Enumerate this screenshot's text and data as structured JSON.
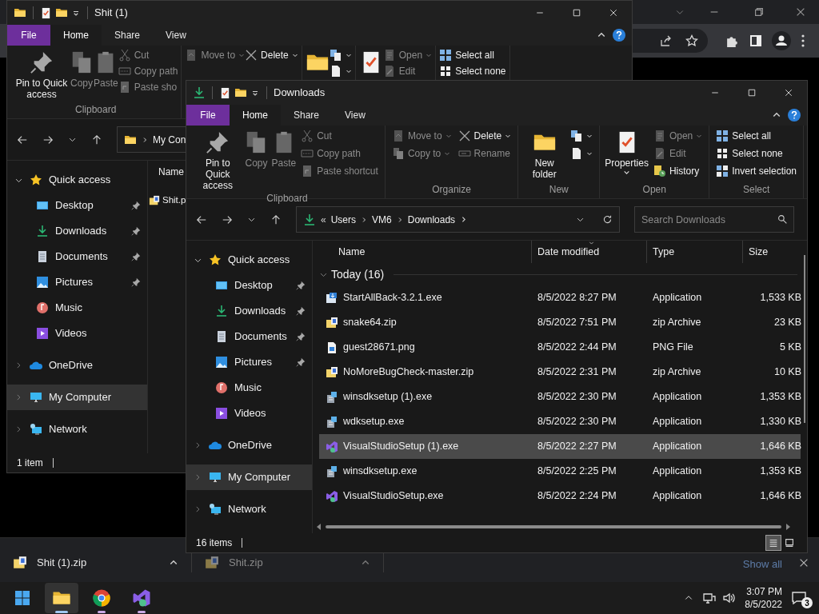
{
  "back_window": {
    "title": "Shit (1)",
    "kind": "folder",
    "file_tab": "File",
    "tabs": [
      {
        "label": "Home",
        "selected": true
      },
      {
        "label": "Share",
        "selected": false
      },
      {
        "label": "View",
        "selected": false
      }
    ],
    "ribbon": [
      {
        "label": "Clipboard",
        "columns": [
          [
            {
              "kind": "pin",
              "label": "Pin to Quick access",
              "disabled": false,
              "menu": false
            }
          ],
          [
            {
              "kind": "copy",
              "label": "Copy",
              "disabled": true,
              "menu": false
            }
          ],
          [
            {
              "kind": "paste",
              "label": "Paste",
              "disabled": true,
              "menu": false
            }
          ],
          [
            {
              "kind": "cut",
              "label": "Cut",
              "disabled": true,
              "menu": false
            },
            {
              "kind": "copypath",
              "label": "Copy path",
              "disabled": true,
              "menu": false
            },
            {
              "kind": "shortcut",
              "label": "Paste sho",
              "disabled": true,
              "menu": false
            }
          ]
        ]
      },
      {
        "columns": [
          [
            {
              "kind": "move",
              "label": "Move to",
              "disabled": true,
              "menu": true
            }
          ],
          [
            {
              "kind": "delete",
              "label": "Delete",
              "disabled": false,
              "menu": true
            }
          ]
        ]
      },
      {
        "columns": [
          [
            {
              "kind": "newfolder",
              "disabled": false,
              "menu": false
            }
          ],
          [
            {
              "kind": "newitem",
              "disabled": false,
              "menu": true
            },
            {
              "kind": "easyaccess",
              "disabled": false,
              "menu": true
            }
          ]
        ]
      },
      {
        "columns": [
          [
            {
              "kind": "properties",
              "disabled": false,
              "menu": false
            }
          ],
          [
            {
              "kind": "open",
              "label": "Open",
              "disabled": true,
              "menu": true
            },
            {
              "kind": "edit",
              "label": "Edit",
              "disabled": true,
              "menu": false
            }
          ]
        ]
      },
      {
        "columns": [
          [
            {
              "kind": "selectall",
              "label": "Select all",
              "disabled": false,
              "menu": false
            },
            {
              "kind": "selectnone",
              "label": "Select none",
              "disabled": false,
              "menu": false
            }
          ]
        ]
      }
    ],
    "address": {
      "crumbs": [
        "My Con"
      ]
    },
    "tree": [
      {
        "label": "Quick access",
        "kind": "star",
        "expanded": true,
        "selected": false,
        "children": [
          {
            "label": "Desktop",
            "kind": "desktop",
            "pinned": true,
            "selected": false
          },
          {
            "label": "Downloads",
            "kind": "download",
            "pinned": true,
            "selected": false
          },
          {
            "label": "Documents",
            "kind": "documents",
            "pinned": true,
            "selected": false
          },
          {
            "label": "Pictures",
            "kind": "pictures",
            "pinned": true,
            "selected": false
          },
          {
            "label": "Music",
            "kind": "music",
            "pinned": false,
            "selected": false
          },
          {
            "label": "Videos",
            "kind": "videos",
            "pinned": false,
            "selected": false
          }
        ]
      },
      {
        "label": "OneDrive",
        "kind": "onedrive",
        "expanded": false,
        "selected": false
      },
      {
        "label": "My Computer",
        "kind": "computer",
        "expanded": false,
        "selected": true
      },
      {
        "label": "Network",
        "kind": "network",
        "expanded": false,
        "selected": false
      }
    ],
    "columns": [
      {
        "label": "Name"
      }
    ],
    "rows": [
      {
        "name": "Shit.p",
        "kind": "zip",
        "selected": false
      }
    ],
    "status": "1 item"
  },
  "front_window": {
    "title": "Downloads",
    "kind": "download",
    "file_tab": "File",
    "tabs": [
      {
        "label": "Home",
        "selected": true
      },
      {
        "label": "Share",
        "selected": false
      },
      {
        "label": "View",
        "selected": false
      }
    ],
    "ribbon": [
      {
        "label": "Clipboard",
        "columns": [
          [
            {
              "kind": "pin",
              "label": "Pin to Quick access",
              "disabled": false,
              "menu": false
            }
          ],
          [
            {
              "kind": "copy",
              "label": "Copy",
              "disabled": true,
              "menu": false
            }
          ],
          [
            {
              "kind": "paste",
              "label": "Paste",
              "disabled": true,
              "menu": false
            }
          ],
          [
            {
              "kind": "cut",
              "label": "Cut",
              "disabled": true,
              "menu": false
            },
            {
              "kind": "copypath",
              "label": "Copy path",
              "disabled": true,
              "menu": false
            },
            {
              "kind": "shortcut",
              "label": "Paste shortcut",
              "disabled": true,
              "menu": false
            }
          ]
        ]
      },
      {
        "label": "Organize",
        "columns": [
          [
            {
              "kind": "move",
              "label": "Move to",
              "disabled": true,
              "menu": true
            },
            {
              "kind": "copyto",
              "label": "Copy to",
              "disabled": true,
              "menu": true
            }
          ],
          [
            {
              "kind": "delete",
              "label": "Delete",
              "disabled": false,
              "menu": true
            },
            {
              "kind": "rename",
              "label": "Rename",
              "disabled": true,
              "menu": false
            }
          ]
        ]
      },
      {
        "label": "New",
        "columns": [
          [
            {
              "kind": "newfolder",
              "label": "New folder",
              "disabled": false,
              "menu": false
            }
          ],
          [
            {
              "kind": "newitem",
              "disabled": false,
              "menu": true
            },
            {
              "kind": "easyaccess",
              "disabled": false,
              "menu": true
            }
          ]
        ]
      },
      {
        "label": "Open",
        "columns": [
          [
            {
              "kind": "properties",
              "label": "Properties",
              "disabled": false,
              "menu": true
            }
          ],
          [
            {
              "kind": "open",
              "label": "Open",
              "disabled": true,
              "menu": true
            },
            {
              "kind": "edit",
              "label": "Edit",
              "disabled": true,
              "menu": false
            },
            {
              "kind": "history",
              "label": "History",
              "disabled": false,
              "menu": false
            }
          ]
        ]
      },
      {
        "label": "Select",
        "columns": [
          [
            {
              "kind": "selectall",
              "label": "Select all",
              "disabled": false,
              "menu": false
            },
            {
              "kind": "selectnone",
              "label": "Select none",
              "disabled": false,
              "menu": false
            },
            {
              "kind": "invert",
              "label": "Invert selection",
              "disabled": false,
              "menu": false
            }
          ]
        ]
      }
    ],
    "address": {
      "overflow": "«",
      "crumbs": [
        "Users",
        "VM6",
        "Downloads"
      ],
      "trailing": true
    },
    "search": {
      "placeholder": "Search Downloads"
    },
    "tree": [
      {
        "label": "Quick access",
        "kind": "star",
        "expanded": true,
        "selected": false,
        "children": [
          {
            "label": "Desktop",
            "kind": "desktop",
            "pinned": true,
            "selected": false
          },
          {
            "label": "Downloads",
            "kind": "download",
            "pinned": true,
            "selected": false
          },
          {
            "label": "Documents",
            "kind": "documents",
            "pinned": true,
            "selected": false
          },
          {
            "label": "Pictures",
            "kind": "pictures",
            "pinned": true,
            "selected": false
          },
          {
            "label": "Music",
            "kind": "music",
            "pinned": false,
            "selected": false
          },
          {
            "label": "Videos",
            "kind": "videos",
            "pinned": false,
            "selected": false
          }
        ]
      },
      {
        "label": "OneDrive",
        "kind": "onedrive",
        "expanded": false,
        "selected": false
      },
      {
        "label": "My Computer",
        "kind": "computer",
        "expanded": false,
        "selected": true
      },
      {
        "label": "Network",
        "kind": "network",
        "expanded": false,
        "selected": false
      }
    ],
    "columns": [
      {
        "label": "Name",
        "sorted": false
      },
      {
        "label": "Date modified",
        "sorted": true
      },
      {
        "label": "Type",
        "sorted": false
      },
      {
        "label": "Size",
        "sorted": false
      }
    ],
    "group": {
      "label": "Today (16)",
      "expanded": true
    },
    "rows": [
      {
        "name": "StartAllBack-3.2.1.exe",
        "date": "8/5/2022 8:27 PM",
        "type": "Application",
        "size": "1,533 KB",
        "kind": "installer",
        "selected": false
      },
      {
        "name": "snake64.zip",
        "date": "8/5/2022 7:51 PM",
        "type": "zip Archive",
        "size": "23 KB",
        "kind": "zip",
        "selected": false
      },
      {
        "name": "guest28671.png",
        "date": "8/5/2022 2:44 PM",
        "type": "PNG File",
        "size": "5 KB",
        "kind": "image",
        "selected": false
      },
      {
        "name": "NoMoreBugCheck-master.zip",
        "date": "8/5/2022 2:31 PM",
        "type": "zip Archive",
        "size": "10 KB",
        "kind": "zip",
        "selected": false
      },
      {
        "name": "winsdksetup (1).exe",
        "date": "8/5/2022 2:30 PM",
        "type": "Application",
        "size": "1,353 KB",
        "kind": "setup",
        "selected": false
      },
      {
        "name": "wdksetup.exe",
        "date": "8/5/2022 2:30 PM",
        "type": "Application",
        "size": "1,330 KB",
        "kind": "setup",
        "selected": false
      },
      {
        "name": "VisualStudioSetup (1).exe",
        "date": "8/5/2022 2:27 PM",
        "type": "Application",
        "size": "1,646 KB",
        "kind": "vs",
        "selected": true
      },
      {
        "name": "winsdksetup.exe",
        "date": "8/5/2022 2:25 PM",
        "type": "Application",
        "size": "1,353 KB",
        "kind": "setup",
        "selected": false
      },
      {
        "name": "VisualStudioSetup.exe",
        "date": "8/5/2022 2:24 PM",
        "type": "Application",
        "size": "1,646 KB",
        "kind": "vs",
        "selected": false
      }
    ],
    "status": "16 items",
    "views": [
      {
        "kind": "details",
        "selected": true
      },
      {
        "kind": "tiles",
        "selected": false
      }
    ]
  },
  "downloads_bar": {
    "items": [
      {
        "name": "Shit (1).zip",
        "faded": false
      },
      {
        "name": "Shit.zip",
        "faded": true
      }
    ],
    "show_all": "Show all"
  },
  "taskbar": {
    "apps": [
      {
        "kind": "folder",
        "selected": true,
        "running": true
      },
      {
        "kind": "browser",
        "selected": false,
        "running": true
      },
      {
        "kind": "vs",
        "selected": false,
        "running": true
      }
    ],
    "time": "3:07 PM",
    "date": "8/5/2022",
    "notifications": "3"
  }
}
